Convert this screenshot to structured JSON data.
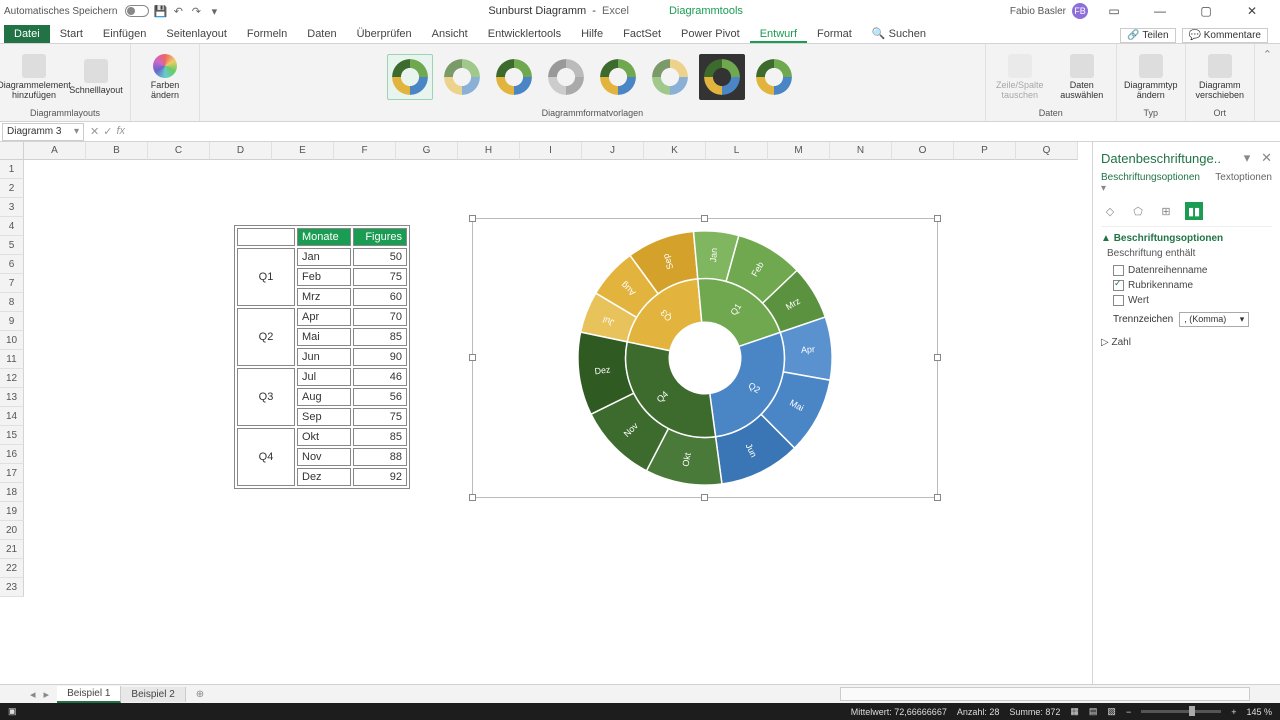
{
  "titlebar": {
    "autosave": "Automatisches Speichern",
    "filename": "Sunburst Diagramm",
    "app": "Excel",
    "chart_tools": "Diagrammtools",
    "user": "Fabio Basler",
    "user_initials": "FB"
  },
  "tabs": {
    "file": "Datei",
    "start": "Start",
    "einfuegen": "Einfügen",
    "seitenlayout": "Seitenlayout",
    "formeln": "Formeln",
    "daten": "Daten",
    "ueberpruefen": "Überprüfen",
    "ansicht": "Ansicht",
    "entwickler": "Entwicklertools",
    "hilfe": "Hilfe",
    "factset": "FactSet",
    "powerpivot": "Power Pivot",
    "entwurf": "Entwurf",
    "format": "Format",
    "suchen": "Suchen",
    "teilen": "Teilen",
    "kommentare": "Kommentare"
  },
  "ribbon": {
    "add_element": "Diagrammelement hinzufügen",
    "schnelllayout": "Schnelllayout",
    "farben": "Farben ändern",
    "layouts_label": "Diagrammlayouts",
    "styles_label": "Diagrammformatvorlagen",
    "zeile_spalte": "Zeile/Spalte tauschen",
    "daten_auswaehlen": "Daten auswählen",
    "daten_label": "Daten",
    "typ_aendern": "Diagrammtyp ändern",
    "typ_label": "Typ",
    "verschieben": "Diagramm verschieben",
    "ort_label": "Ort"
  },
  "namebox": "Diagramm 3",
  "columns": [
    "A",
    "B",
    "C",
    "D",
    "E",
    "F",
    "G",
    "H",
    "I",
    "J",
    "K",
    "L",
    "M",
    "N",
    "O",
    "P",
    "Q"
  ],
  "table": {
    "hdr_monate": "Monate",
    "hdr_figures": "Figures",
    "q1": "Q1",
    "q2": "Q2",
    "q3": "Q3",
    "q4": "Q4",
    "rows": [
      {
        "m": "Jan",
        "v": 50
      },
      {
        "m": "Feb",
        "v": 75
      },
      {
        "m": "Mrz",
        "v": 60
      },
      {
        "m": "Apr",
        "v": 70
      },
      {
        "m": "Mai",
        "v": 85
      },
      {
        "m": "Jun",
        "v": 90
      },
      {
        "m": "Jul",
        "v": 46
      },
      {
        "m": "Aug",
        "v": 56
      },
      {
        "m": "Sep",
        "v": 75
      },
      {
        "m": "Okt",
        "v": 85
      },
      {
        "m": "Nov",
        "v": 88
      },
      {
        "m": "Dez",
        "v": 92
      }
    ]
  },
  "chart_data": {
    "type": "sunburst",
    "title": "",
    "inner": [
      {
        "name": "Q1",
        "color": "#6fa84f",
        "children": [
          "Jan",
          "Feb",
          "Mrz"
        ]
      },
      {
        "name": "Q2",
        "color": "#4a86c5",
        "children": [
          "Apr",
          "Mai",
          "Jun"
        ]
      },
      {
        "name": "Q3",
        "color": "#e2b43e",
        "children": [
          "Jul",
          "Aug",
          "Sep"
        ]
      },
      {
        "name": "Q4",
        "color": "#3d6b2e",
        "children": [
          "Okt",
          "Nov",
          "Dez"
        ]
      }
    ],
    "values": {
      "Jan": 50,
      "Feb": 75,
      "Mrz": 60,
      "Apr": 70,
      "Mai": 85,
      "Jun": 90,
      "Jul": 46,
      "Aug": 56,
      "Sep": 75,
      "Okt": 85,
      "Nov": 88,
      "Dez": 92
    },
    "colors": {
      "Q1": "#6fa84f",
      "Jan": "#7fb65f",
      "Feb": "#6fa84f",
      "Mrz": "#5a9240",
      "Q2": "#4a86c5",
      "Apr": "#5a92cf",
      "Mai": "#4a86c5",
      "Jun": "#3a76b5",
      "Q3": "#e2b43e",
      "Jul": "#e8c25a",
      "Aug": "#e2b43e",
      "Sep": "#d4a22a",
      "Q4": "#3d6b2e",
      "Okt": "#4a7a3a",
      "Nov": "#3d6b2e",
      "Dez": "#2f5a22"
    }
  },
  "panel": {
    "title": "Datenbeschriftunge..",
    "tab_opt": "Beschriftungsoptionen",
    "tab_text": "Textoptionen",
    "section": "Beschriftungsoptionen",
    "contains": "Beschriftung enthält",
    "datenreihe": "Datenreihenname",
    "rubrik": "Rubrikenname",
    "wert": "Wert",
    "trenn": "Trennzeichen",
    "trenn_val": ", (Komma)",
    "zahl": "Zahl"
  },
  "sheets": {
    "s1": "Beispiel 1",
    "s2": "Beispiel 2"
  },
  "status": {
    "mittel": "Mittelwert: 72,66666667",
    "anzahl": "Anzahl: 28",
    "summe": "Summe: 872",
    "zoom": "145 %"
  }
}
